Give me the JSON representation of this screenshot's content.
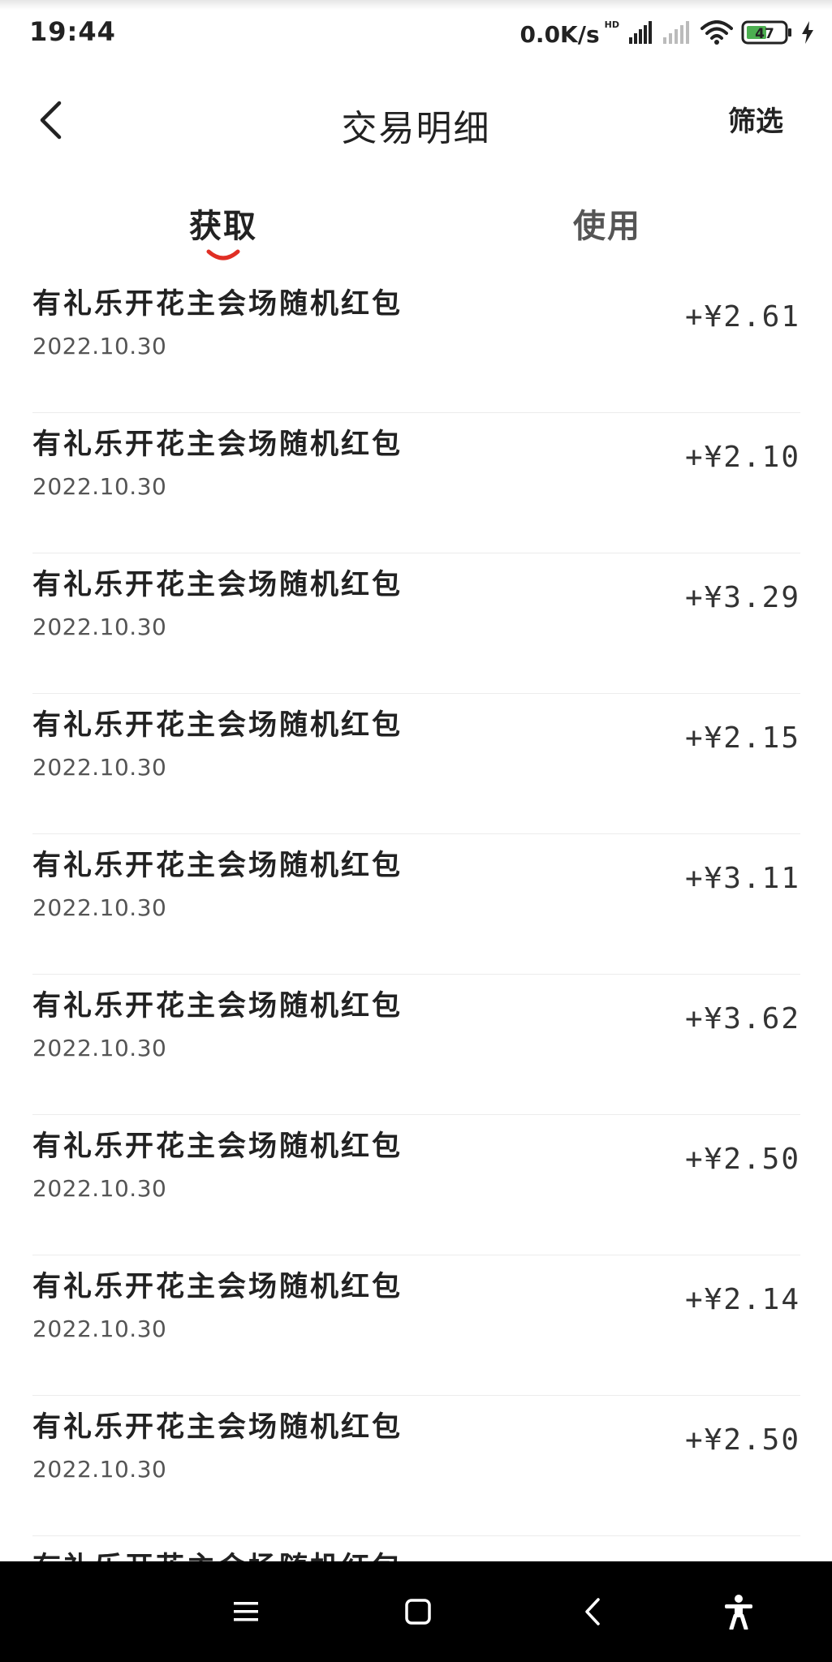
{
  "status_bar": {
    "time": "19:44",
    "network_speed": "0.0K/s",
    "hd_label": "HD",
    "battery": "47",
    "icons": [
      "signal-icon",
      "signal-weak-icon",
      "wifi-icon",
      "battery-icon",
      "charging-icon"
    ]
  },
  "header": {
    "title": "交易明细",
    "filter_label": "筛选",
    "back_icon": "chevron-left-icon"
  },
  "tabs": [
    {
      "label": "获取",
      "active": true
    },
    {
      "label": "使用",
      "active": false
    }
  ],
  "colors": {
    "accent": "#e02e24",
    "text_primary": "#222222",
    "text_secondary": "#555555",
    "divider": "#ececec",
    "nav_bar": "#000000"
  },
  "transactions": [
    {
      "title": "有礼乐开花主会场随机红包",
      "date": "2022.10.30",
      "amount": "+¥2.61"
    },
    {
      "title": "有礼乐开花主会场随机红包",
      "date": "2022.10.30",
      "amount": "+¥2.10"
    },
    {
      "title": "有礼乐开花主会场随机红包",
      "date": "2022.10.30",
      "amount": "+¥3.29"
    },
    {
      "title": "有礼乐开花主会场随机红包",
      "date": "2022.10.30",
      "amount": "+¥2.15"
    },
    {
      "title": "有礼乐开花主会场随机红包",
      "date": "2022.10.30",
      "amount": "+¥3.11"
    },
    {
      "title": "有礼乐开花主会场随机红包",
      "date": "2022.10.30",
      "amount": "+¥3.62"
    },
    {
      "title": "有礼乐开花主会场随机红包",
      "date": "2022.10.30",
      "amount": "+¥2.50"
    },
    {
      "title": "有礼乐开花主会场随机红包",
      "date": "2022.10.30",
      "amount": "+¥2.14"
    },
    {
      "title": "有礼乐开花主会场随机红包",
      "date": "2022.10.30",
      "amount": "+¥2.50"
    },
    {
      "title": "有礼乐开花主会场随机红包",
      "date": "",
      "amount": ""
    }
  ],
  "nav_bar": {
    "icons": [
      "menu-icon",
      "home-icon",
      "back-icon",
      "accessibility-icon"
    ]
  }
}
